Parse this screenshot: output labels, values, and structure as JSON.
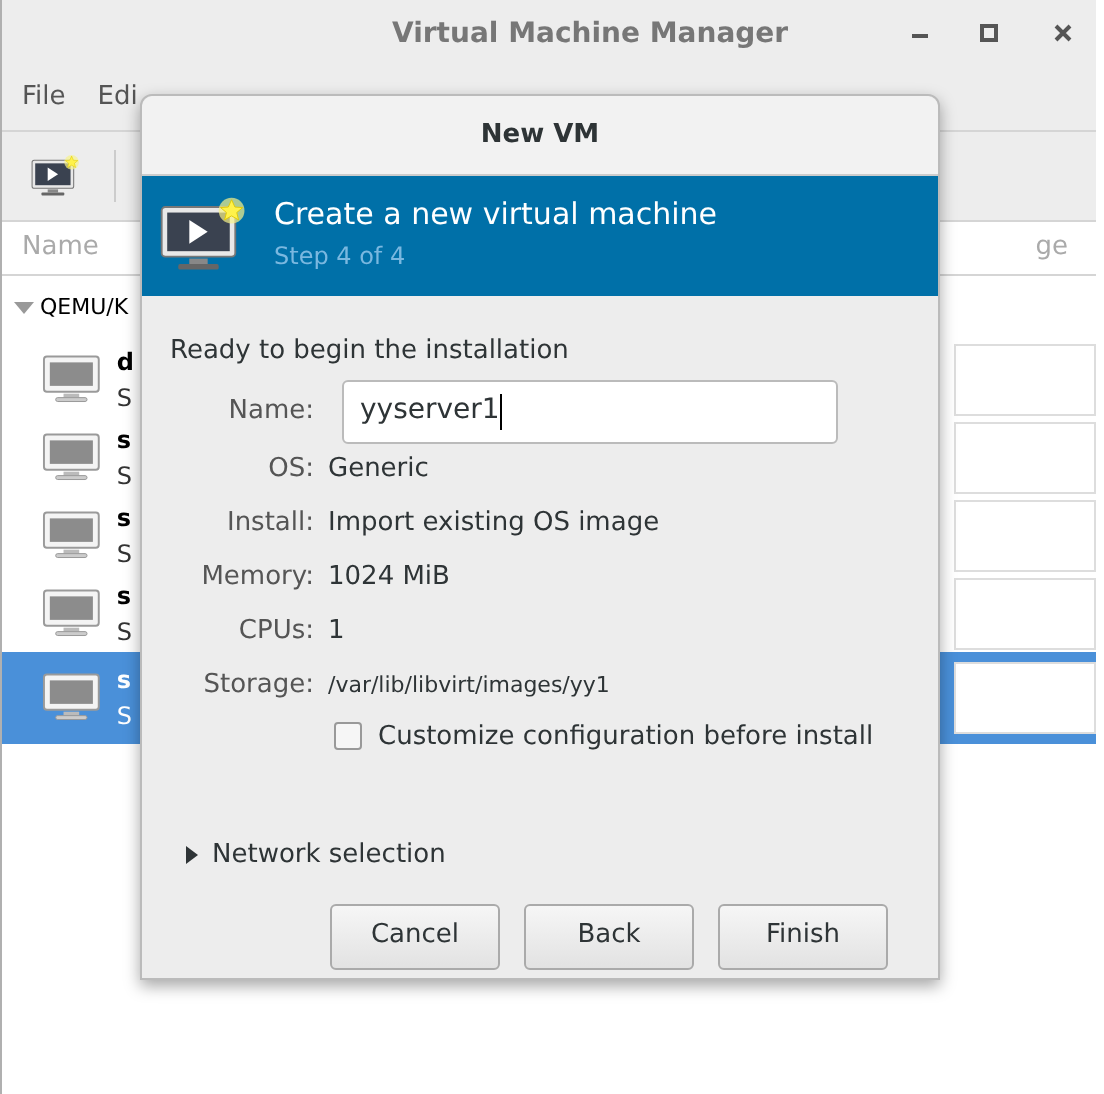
{
  "window": {
    "title": "Virtual Machine Manager"
  },
  "menu": [
    "File",
    "Edi"
  ],
  "table": {
    "columns": [
      "Name",
      "ge"
    ],
    "group": {
      "label": "QEMU/K",
      "expanded": true
    },
    "rows": [
      {
        "name": "d",
        "status": "S",
        "selected": false
      },
      {
        "name": "s",
        "status": "S",
        "selected": false
      },
      {
        "name": "s",
        "status": "S",
        "selected": false
      },
      {
        "name": "s",
        "status": "S",
        "selected": false
      },
      {
        "name": "s",
        "status": "S",
        "selected": true
      }
    ]
  },
  "dialog": {
    "title": "New VM",
    "banner": {
      "title": "Create a new virtual machine",
      "step": "Step 4 of 4"
    },
    "heading": "Ready to begin the installation",
    "name_field": {
      "label": "Name:",
      "value": "yyserver1"
    },
    "details": [
      {
        "label": "OS:",
        "value": "Generic",
        "kind": "normal"
      },
      {
        "label": "Install:",
        "value": "Import existing OS image",
        "kind": "normal"
      },
      {
        "label": "Memory:",
        "value": "1024 MiB",
        "kind": "normal"
      },
      {
        "label": "CPUs:",
        "value": "1",
        "kind": "normal"
      },
      {
        "label": "Storage:",
        "value": "/var/lib/libvirt/images/yy1",
        "kind": "small"
      }
    ],
    "customize": {
      "label": "Customize configuration before install",
      "checked": false
    },
    "network": {
      "label": "Network selection",
      "expanded": false
    },
    "buttons": [
      "Cancel",
      "Back",
      "Finish"
    ]
  }
}
